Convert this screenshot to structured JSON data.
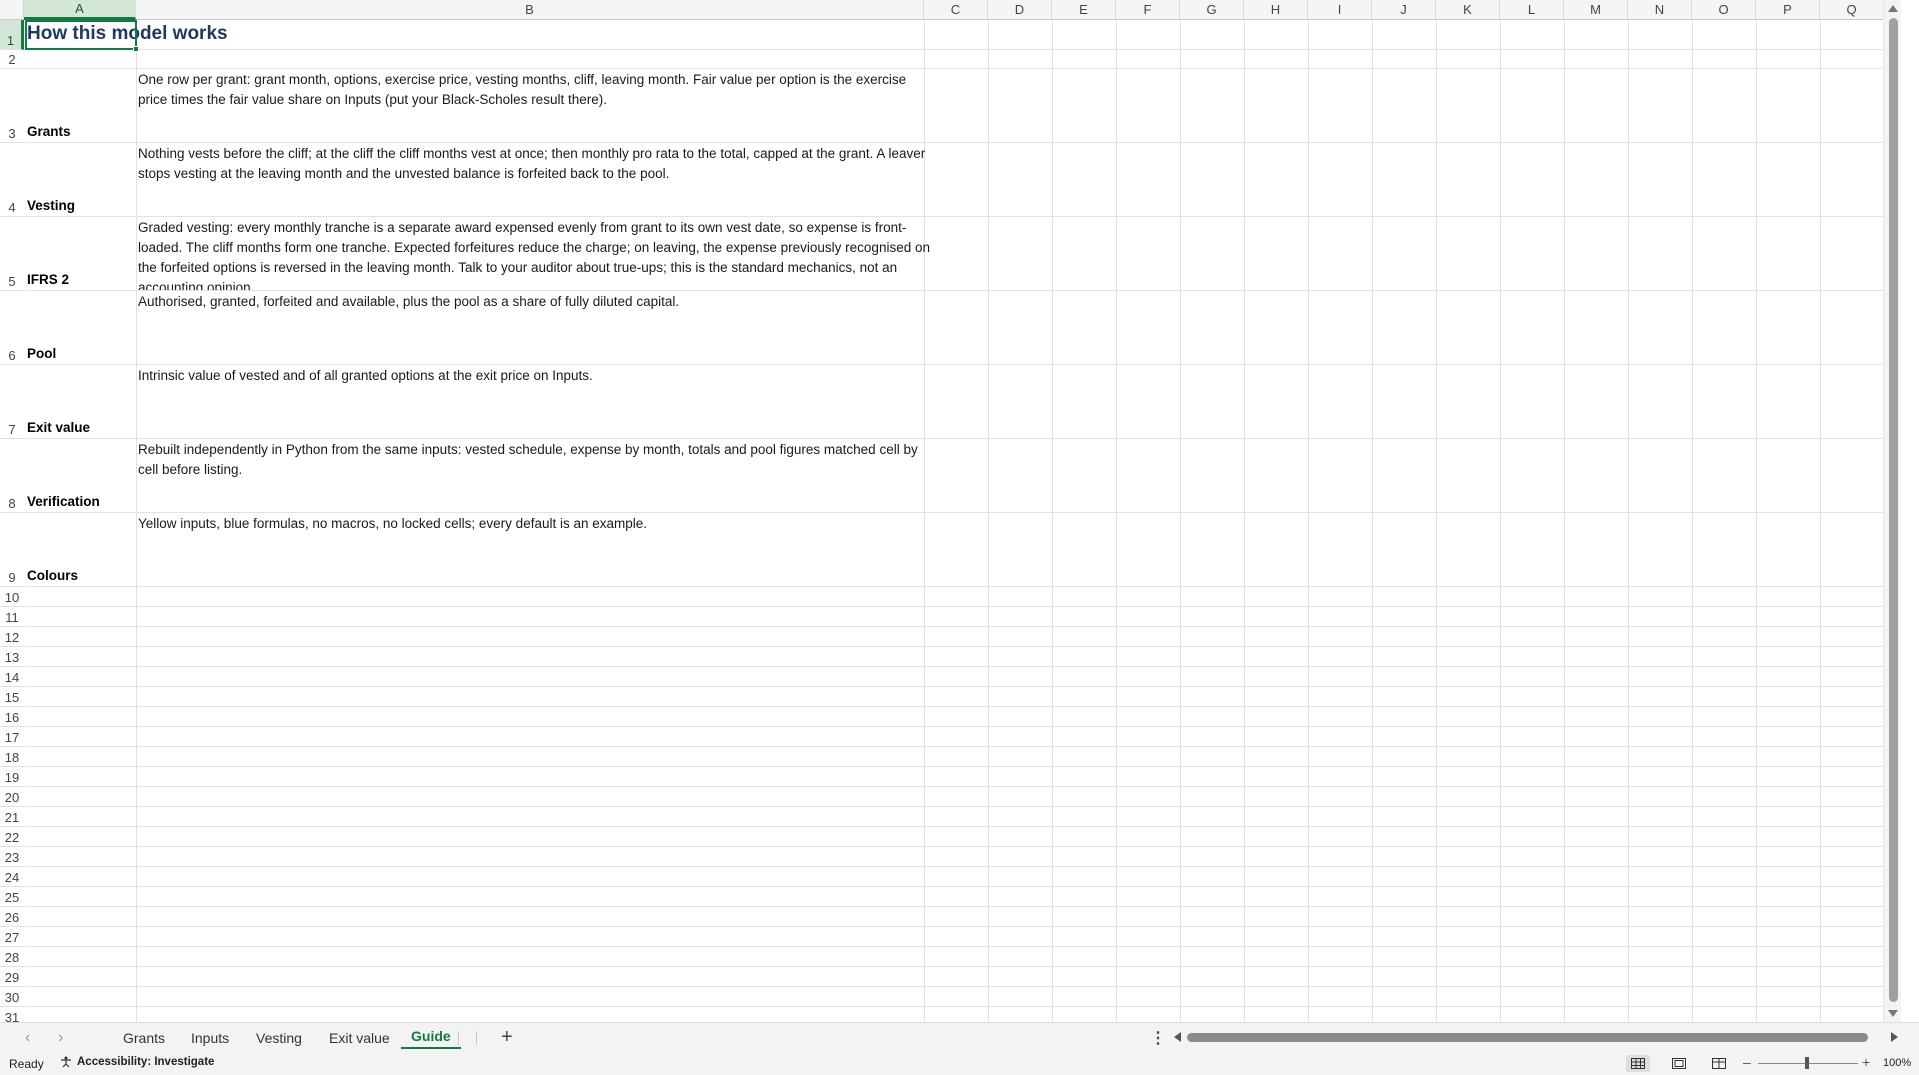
{
  "sheet": {
    "columns": [
      "A",
      "B",
      "C",
      "D",
      "E",
      "F",
      "G",
      "H",
      "I",
      "J",
      "K",
      "L",
      "M",
      "N",
      "O",
      "P",
      "Q"
    ],
    "selected_column": "A",
    "selected_row": "1",
    "title": "How this model works",
    "rows": [
      {
        "num": "1"
      },
      {
        "num": "2"
      },
      {
        "num": "3",
        "label": "Grants",
        "text": "One row per grant: grant month, options, exercise price, vesting months, cliff, leaving month. Fair value per option is the exercise price times the fair value share on Inputs (put your Black-Scholes result there)."
      },
      {
        "num": "4",
        "label": "Vesting",
        "text": "Nothing vests before the cliff; at the cliff the cliff months vest at once; then monthly pro rata to the total, capped at the grant. A leaver stops vesting at the leaving month and the unvested balance is forfeited back to the pool."
      },
      {
        "num": "5",
        "label": "IFRS 2",
        "text": "Graded vesting: every monthly tranche is a separate award expensed evenly from grant to its own vest date, so expense is front-loaded. The cliff months form one tranche. Expected forfeitures reduce the charge; on leaving, the expense previously recognised on the forfeited options is reversed in the leaving month. Talk to your auditor about true-ups; this is the standard mechanics, not an accounting opinion."
      },
      {
        "num": "6",
        "label": "Pool",
        "text": "Authorised, granted, forfeited and available, plus the pool as a share of fully diluted capital."
      },
      {
        "num": "7",
        "label": "Exit value",
        "text": "Intrinsic value of vested and of all granted options at the exit price on Inputs."
      },
      {
        "num": "8",
        "label": "Verification",
        "text": "Rebuilt independently in Python from the same inputs: vested schedule, expense by month, totals and pool figures matched cell by cell before listing."
      },
      {
        "num": "9",
        "label": "Colours",
        "text": "Yellow inputs, blue formulas, no macros, no locked cells; every default is an example."
      },
      {
        "num": "10"
      },
      {
        "num": "11"
      },
      {
        "num": "12"
      },
      {
        "num": "13"
      },
      {
        "num": "14"
      },
      {
        "num": "15"
      },
      {
        "num": "16"
      },
      {
        "num": "17"
      },
      {
        "num": "18"
      },
      {
        "num": "19"
      },
      {
        "num": "20"
      },
      {
        "num": "21"
      },
      {
        "num": "22"
      },
      {
        "num": "23"
      },
      {
        "num": "24"
      },
      {
        "num": "25"
      },
      {
        "num": "26"
      },
      {
        "num": "27"
      },
      {
        "num": "28"
      },
      {
        "num": "29"
      },
      {
        "num": "30"
      },
      {
        "num": "31"
      }
    ]
  },
  "tabs": [
    "Grants",
    "Inputs",
    "Vesting",
    "Exit value",
    "Guide"
  ],
  "active_tab": "Guide",
  "add_tab": "+",
  "status": {
    "ready": "Ready",
    "accessibility": "Accessibility: Investigate",
    "zoom": "100%"
  },
  "colors": {
    "accent": "#107c41",
    "title": "#1f3864"
  }
}
